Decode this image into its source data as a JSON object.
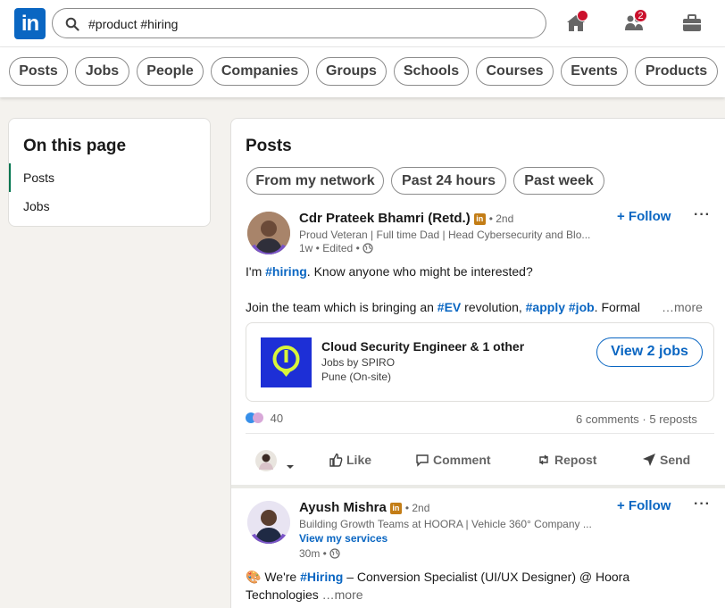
{
  "brand": {
    "logo_text": "in",
    "accent": "#0a66c2"
  },
  "search": {
    "value": "#product #hiring",
    "icon": "search-icon"
  },
  "nav": {
    "home_icon": "home-icon",
    "network_icon": "people-icon",
    "network_badge": "2",
    "jobs_icon": "briefcase-icon"
  },
  "filters": [
    "Posts",
    "Jobs",
    "People",
    "Companies",
    "Groups",
    "Schools",
    "Courses",
    "Events",
    "Products"
  ],
  "on_this_page": {
    "title": "On this page",
    "items": [
      "Posts",
      "Jobs"
    ]
  },
  "posts_section": {
    "title": "Posts",
    "filters": [
      "From my network",
      "Past 24 hours",
      "Past week"
    ]
  },
  "post1": {
    "author": "Cdr Prateek Bhamri (Retd.)",
    "degree": "• 2nd",
    "headline": "Proud Veteran | Full time Dad | Head Cybersecurity and Blo...",
    "meta": "1w • Edited •",
    "follow": "+ Follow",
    "line1_pre": "I'm ",
    "line1_tag": "#hiring",
    "line1_post": ". Know anyone who might be interested?",
    "line2_pre": "Join the team which is bringing an ",
    "line2_tag1": "#EV",
    "line2_mid": " revolution, ",
    "line2_tag2": "#apply",
    "line2_sp": " ",
    "line2_tag3": "#job",
    "line2_post": ". Formal",
    "see_more": "…more",
    "job": {
      "title": "Cloud Security Engineer & 1 other",
      "company": "Jobs by SPIRO",
      "location": "Pune (On-site)",
      "button": "View 2 jobs"
    },
    "reaction_count": "40",
    "counts": "6 comments · 5 reposts",
    "actions": {
      "like": "Like",
      "comment": "Comment",
      "repost": "Repost",
      "send": "Send"
    }
  },
  "post2": {
    "author": "Ayush Mishra",
    "degree": "• 2nd",
    "headline": "Building Growth Teams at HOORA | Vehicle 360° Company ...",
    "services": "View my services",
    "meta": "30m •",
    "follow": "+ Follow",
    "line1_emoji": "🎨",
    "line1_pre": " We're ",
    "line1_tag": "#Hiring",
    "line1_post": " – Conversion Specialist (UI/UX Designer) @ Hoora",
    "line2": "Technologies  ",
    "see_more": "…more"
  }
}
